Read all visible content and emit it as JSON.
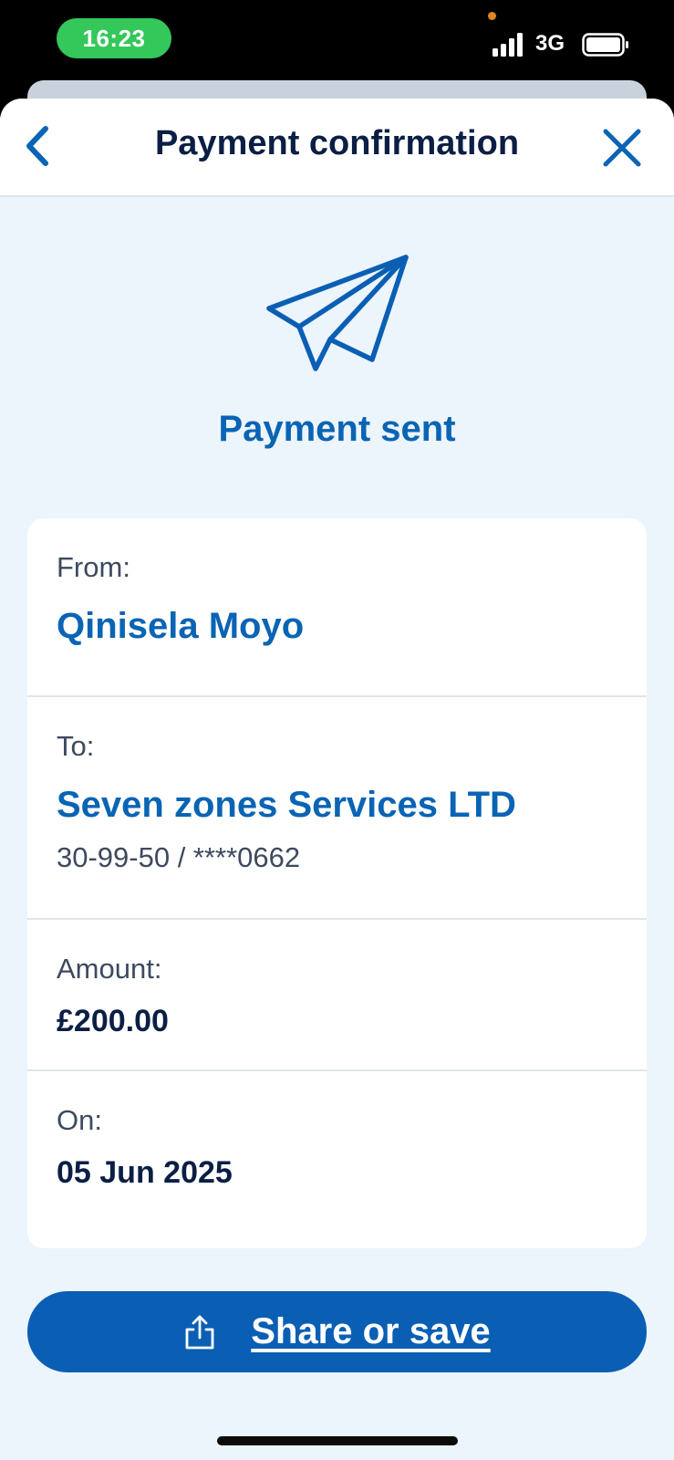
{
  "status_bar": {
    "time": "16:23",
    "network": "3G"
  },
  "nav": {
    "title": "Payment confirmation",
    "back_icon": "chevron-left-icon",
    "close_icon": "close-icon"
  },
  "hero": {
    "icon": "paper-plane-icon",
    "title": "Payment sent"
  },
  "details": {
    "from_label": "From:",
    "from_value": "Qinisela Moyo",
    "to_label": "To:",
    "to_value": "Seven zones Services LTD",
    "to_account": "30-99-50 / ****0662",
    "amount_label": "Amount:",
    "amount_value": "£200.00",
    "date_label": "On:",
    "date_value": "05 Jun 2025"
  },
  "actions": {
    "share_label": "Share or save",
    "share_icon": "share-icon"
  },
  "colors": {
    "accent": "#0a64b4",
    "button": "#0a5fb4",
    "background": "#ecf4fc",
    "time_pill": "#34c759"
  }
}
